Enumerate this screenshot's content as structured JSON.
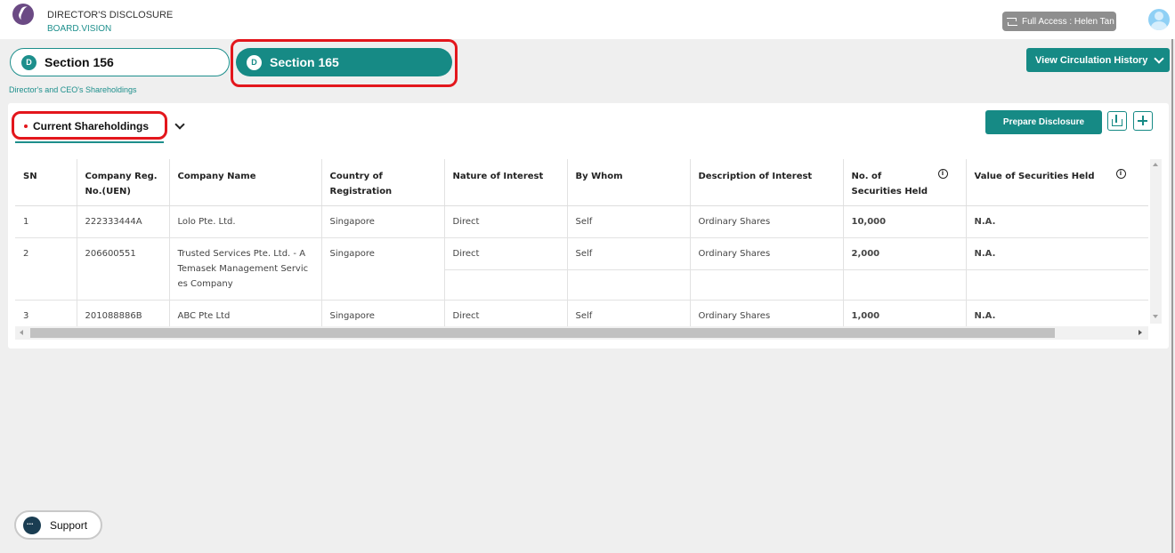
{
  "header": {
    "app_title": "DIRECTOR'S DISCLOSURE",
    "app_subtitle": "BOARD.VISION",
    "access_label": "Full Access : Helen Tan"
  },
  "sections": {
    "section156": {
      "icon_letter": "D",
      "label": "Section 156"
    },
    "section165": {
      "icon_letter": "D",
      "label": "Section 165"
    }
  },
  "breadcrumb": "Director's and CEO's Shareholdings",
  "circulation_button": "View Circulation History",
  "card": {
    "current_tab": "Current Shareholdings",
    "prepare_button": "Prepare Disclosure"
  },
  "table": {
    "columns": [
      "SN",
      "Company Reg. No.(UEN)",
      "Company Name",
      "Country of Registration",
      "Nature of Interest",
      "By Whom",
      "Description of Interest",
      "No. of Securities Held",
      "Value of Securities Held"
    ],
    "rows": [
      {
        "sn": "1",
        "uen": "222333444A",
        "company": "Lolo Pte. Ltd.",
        "country": "Singapore",
        "nature": "Direct",
        "by_whom": "Self",
        "description": "Ordinary Shares",
        "securities": "10,000",
        "value": "N.A."
      },
      {
        "sn": "2",
        "uen": "206600551",
        "company": "Trusted Services Pte. Ltd. - A Temasek Management Services Company",
        "country": "Singapore",
        "nature": "Direct",
        "by_whom": "Self",
        "description": "Ordinary Shares",
        "securities": "2,000",
        "value": "N.A."
      },
      {
        "sn": "3",
        "uen": "201088886B",
        "company": "ABC Pte Ltd",
        "country": "Singapore",
        "nature": "Direct",
        "by_whom": "Self",
        "description": "Ordinary Shares",
        "securities": "1,000",
        "value": "N.A."
      }
    ]
  },
  "support_label": "Support",
  "colors": {
    "accent": "#168a85",
    "highlight": "#e3161c",
    "value_green": "#1ab395"
  },
  "icons": [
    "logo-icon",
    "swap-icon",
    "user-avatar-icon",
    "d-badge-icon",
    "chevron-down-icon",
    "download-icon",
    "plus-icon",
    "info-icon",
    "chat-icon"
  ]
}
